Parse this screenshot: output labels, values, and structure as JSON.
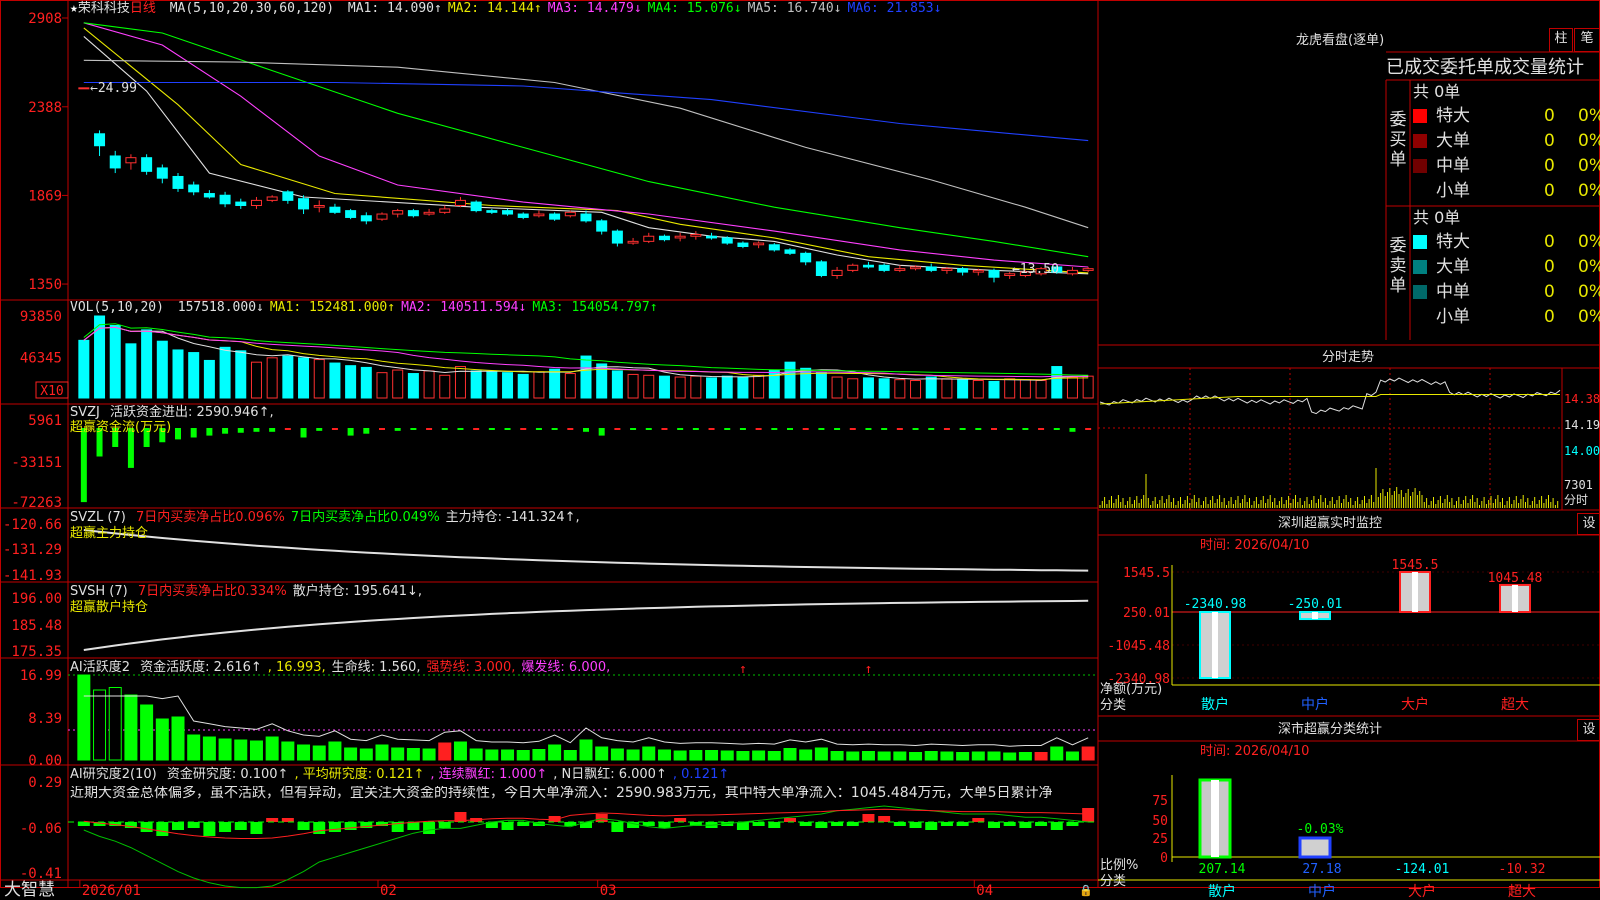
{
  "stock": {
    "name": "荣科科技",
    "period": "日线"
  },
  "panels": {
    "price": {
      "title": "MA(5,10,20,30,60,120)",
      "labels": [
        {
          "text": "MA1: 14.090↑",
          "color": "#e0e0e0"
        },
        {
          "text": "MA2: 14.144↑",
          "color": "#e8e800"
        },
        {
          "text": "MA3: 14.479↓",
          "color": "#ff40ff"
        },
        {
          "text": "MA4: 15.076↓",
          "color": "#00ff00"
        },
        {
          "text": "MA5: 16.740↓",
          "color": "#c0c0c0"
        },
        {
          "text": "MA6: 21.853↓",
          "color": "#2040ff"
        }
      ],
      "yticks": [
        "2908",
        "2388",
        "1869",
        "1350"
      ],
      "high_mark": "24.99",
      "low_mark": "13.50"
    },
    "vol": {
      "title": "VOL(5,10,20)",
      "labels": [
        {
          "text": "157518.000↓",
          "color": "#e0e0e0"
        },
        {
          "text": "MA1: 152481.000↑",
          "color": "#e8e800"
        },
        {
          "text": "MA2: 140511.594↓",
          "color": "#ff40ff"
        },
        {
          "text": "MA3: 154054.797↑",
          "color": "#00ff00"
        }
      ],
      "yticks": [
        "93850",
        "46345"
      ],
      "unit": "X10"
    },
    "svzj": {
      "title": "SVZJ",
      "labels": [
        {
          "text": "活跃资金进出: 2590.946↑,",
          "color": "#e0e0e0"
        }
      ],
      "subtitle": "超赢资金流(万元)",
      "yticks": [
        "5961",
        "-33151",
        "-72263"
      ]
    },
    "svzl": {
      "title": "SVZL (7)",
      "labels": [
        {
          "text": "7日内买卖净占比0.096%",
          "color": "#ff2020"
        },
        {
          "text": "7日内买卖净占比0.049%",
          "color": "#00ff00"
        },
        {
          "text": "主力持仓: -141.324↑,",
          "color": "#e0e0e0"
        }
      ],
      "subtitle": "超赢主力持仓",
      "yticks": [
        "-120.66",
        "-131.29",
        "-141.93"
      ]
    },
    "svsh": {
      "title": "SVSH (7)",
      "labels": [
        {
          "text": "7日内买卖净占比0.334%",
          "color": "#ff2020"
        },
        {
          "text": "散户持仓: 195.641↓,",
          "color": "#e0e0e0"
        }
      ],
      "subtitle": "超赢散户持仓",
      "yticks": [
        "196.00",
        "185.48",
        "175.35"
      ]
    },
    "ai1": {
      "title": "AI活跃度2",
      "labels": [
        {
          "text": "资金活跃度: 2.616↑",
          "color": "#e0e0e0"
        },
        {
          "text": ", 16.993,",
          "color": "#e8e800"
        },
        {
          "text": "生命线: 1.560,",
          "color": "#e0e0e0"
        },
        {
          "text": "强势线: 3.000,",
          "color": "#ff2020"
        },
        {
          "text": "爆发线: 6.000,",
          "color": "#ff40ff"
        }
      ],
      "yticks": [
        "16.99",
        "8.39",
        "0.00"
      ]
    },
    "ai2": {
      "title": "AI研究度2(10)",
      "labels": [
        {
          "text": "资金研究度: 0.100↑",
          "color": "#e0e0e0"
        },
        {
          "text": ", 平均研究度: 0.121↑",
          "color": "#e8e800"
        },
        {
          "text": ", 连续飘红: 1.000↑",
          "color": "#ff40ff"
        },
        {
          "text": ", N日飘红: 6.000↑",
          "color": "#e0e0e0"
        },
        {
          "text": ", 0.121↑",
          "color": "#2040ff"
        }
      ],
      "comment": "近期大资金总体偏多，虽不活跃，但有异动，宜关注大资金的持续性，今日大单净流入：2590.983万元，其中特大单净流入：1045.484万元，大单5日累计净",
      "yticks": [
        "0.29",
        "-0.06",
        "-0.41"
      ]
    }
  },
  "x_axis": [
    "2026/01",
    "02",
    "03",
    "04"
  ],
  "brand": "大智慧",
  "right": {
    "lhkp": {
      "title": "龙虎看盘(逐单)",
      "btn1": "柱",
      "btn2": "笔",
      "subtitle": "已成交委托单成交量统计",
      "buy": {
        "side_label": "委买单",
        "total": "共 0单",
        "rows": [
          {
            "name": "特大",
            "count": "0",
            "pct": "0%",
            "color": "#ff0000"
          },
          {
            "name": "大单",
            "count": "0",
            "pct": "0%",
            "color": "#900000"
          },
          {
            "name": "中单",
            "count": "0",
            "pct": "0%",
            "color": "#700000"
          },
          {
            "name": "小单",
            "count": "0",
            "pct": "0%",
            "color": "#000000"
          }
        ]
      },
      "sell": {
        "side_label": "委卖单",
        "total": "共 0单",
        "rows": [
          {
            "name": "特大",
            "count": "0",
            "pct": "0%",
            "color": "#00ffff"
          },
          {
            "name": "大单",
            "count": "0",
            "pct": "0%",
            "color": "#008080"
          },
          {
            "name": "中单",
            "count": "0",
            "pct": "0%",
            "color": "#006868"
          },
          {
            "name": "小单",
            "count": "0",
            "pct": "0%",
            "color": "#000000"
          }
        ]
      }
    },
    "intraday": {
      "title": "分时走势",
      "yticks": [
        "14.38",
        "14.19",
        "14.00"
      ],
      "vol_label": "7301",
      "unit": "分时"
    },
    "sz_monitor": {
      "title": "深圳超赢实时监控",
      "btn": "设",
      "time": "时间: 2026/04/10",
      "yticks": [
        "1545.5",
        "250.01",
        "-1045.48",
        "-2340.98"
      ],
      "ylabel": "净额(万元)",
      "xlabel": "分类",
      "chart_data": {
        "type": "bar",
        "categories": [
          "散户",
          "中户",
          "大户",
          "超大"
        ],
        "values": [
          -2340.98,
          -250.01,
          1545.5,
          1045.48
        ],
        "value_labels": [
          "-2340.98",
          "-250.01",
          "1545.5",
          "1045.48"
        ],
        "ylim": [
          -2340.98,
          1545.5
        ]
      }
    },
    "sz_class": {
      "title": "深市超赢分类统计",
      "btn": "设",
      "time": "时间: 2026/04/10",
      "yticks": [
        "75",
        "50",
        "25",
        "0"
      ],
      "ylabel": "比例%",
      "xlabel": "分类",
      "chart_data": {
        "type": "bar",
        "categories": [
          "散户",
          "中户",
          "大户",
          "超大"
        ],
        "values": [
          207.14,
          27.18,
          -124.01,
          -10.32
        ],
        "pct_label": "-0.03%",
        "value_labels": [
          "207.14",
          "27.18",
          "-124.01",
          "-10.32"
        ]
      }
    }
  },
  "chart_data": [
    {
      "type": "candlestick",
      "panel": "price",
      "ylim": [
        12.8,
        29.08
      ],
      "candles": [
        [
          24.99,
          24.99,
          22.9,
          22.9
        ],
        [
          22.3,
          21.6,
          21.0,
          22.5
        ],
        [
          21.0,
          20.3,
          20.0,
          21.3
        ],
        [
          20.6,
          20.9,
          20.2,
          21.1
        ],
        [
          20.9,
          20.1,
          19.9,
          21.1
        ],
        [
          20.3,
          19.7,
          19.4,
          20.5
        ],
        [
          19.8,
          19.1,
          18.9,
          20.0
        ],
        [
          19.3,
          18.9,
          18.7,
          19.5
        ],
        [
          18.8,
          18.6,
          18.5,
          19.0
        ],
        [
          18.7,
          18.2,
          18.0,
          18.9
        ],
        [
          18.3,
          18.1,
          17.9,
          18.5
        ],
        [
          18.1,
          18.4,
          17.9,
          18.6
        ],
        [
          18.4,
          18.6,
          18.3,
          18.7
        ],
        [
          18.9,
          18.4,
          18.2,
          19.0
        ],
        [
          18.5,
          17.9,
          17.6,
          18.7
        ],
        [
          18.0,
          18.1,
          17.7,
          18.4
        ],
        [
          18.0,
          17.7,
          17.6,
          18.2
        ],
        [
          17.8,
          17.4,
          17.3,
          17.9
        ],
        [
          17.5,
          17.2,
          17.0,
          17.7
        ],
        [
          17.3,
          17.6,
          17.2,
          17.7
        ],
        [
          17.6,
          17.8,
          17.4,
          17.9
        ],
        [
          17.8,
          17.5,
          17.4,
          17.9
        ],
        [
          17.6,
          17.7,
          17.5,
          17.9
        ],
        [
          17.7,
          17.9,
          17.6,
          18.1
        ],
        [
          18.1,
          18.4,
          18.0,
          18.6
        ],
        [
          18.3,
          17.8,
          17.7,
          18.4
        ],
        [
          17.8,
          17.7,
          17.6,
          17.9
        ],
        [
          17.8,
          17.6,
          17.5,
          17.9
        ],
        [
          17.6,
          17.4,
          17.3,
          17.7
        ],
        [
          17.5,
          17.6,
          17.4,
          17.8
        ],
        [
          17.6,
          17.3,
          17.2,
          17.7
        ],
        [
          17.5,
          17.7,
          17.4,
          17.8
        ],
        [
          17.6,
          17.2,
          17.1,
          17.8
        ],
        [
          17.2,
          16.6,
          16.4,
          17.3
        ],
        [
          16.6,
          15.9,
          15.7,
          16.7
        ],
        [
          15.9,
          16.0,
          15.8,
          16.2
        ],
        [
          16.0,
          16.3,
          15.9,
          16.5
        ],
        [
          16.3,
          16.1,
          16.0,
          16.4
        ],
        [
          16.2,
          16.3,
          16.0,
          16.5
        ],
        [
          16.3,
          16.4,
          16.1,
          16.6
        ],
        [
          16.3,
          16.2,
          16.1,
          16.5
        ],
        [
          16.2,
          15.9,
          15.8,
          16.3
        ],
        [
          15.9,
          15.7,
          15.6,
          16.0
        ],
        [
          15.8,
          15.9,
          15.6,
          16.0
        ],
        [
          15.8,
          15.5,
          15.4,
          15.9
        ],
        [
          15.5,
          15.3,
          15.2,
          15.6
        ],
        [
          15.3,
          14.8,
          14.6,
          15.4
        ],
        [
          14.8,
          14.0,
          13.9,
          14.9
        ],
        [
          14.0,
          14.3,
          13.8,
          14.5
        ],
        [
          14.3,
          14.6,
          14.2,
          14.7
        ],
        [
          14.6,
          14.5,
          14.4,
          14.8
        ],
        [
          14.6,
          14.3,
          14.2,
          14.7
        ],
        [
          14.3,
          14.4,
          14.2,
          14.6
        ],
        [
          14.4,
          14.5,
          14.3,
          14.6
        ],
        [
          14.5,
          14.3,
          14.2,
          14.7
        ],
        [
          14.3,
          14.4,
          14.1,
          14.5
        ],
        [
          14.4,
          14.2,
          14.0,
          14.5
        ],
        [
          14.2,
          14.3,
          14.0,
          14.4
        ],
        [
          14.3,
          13.9,
          13.6,
          14.4
        ],
        [
          14.0,
          14.1,
          13.8,
          14.2
        ],
        [
          14.0,
          14.2,
          13.9,
          14.3
        ],
        [
          14.1,
          14.4,
          14.0,
          14.5
        ],
        [
          14.5,
          14.2,
          14.1,
          14.6
        ],
        [
          14.1,
          14.3,
          14.0,
          14.5
        ],
        [
          14.3,
          14.4,
          14.2,
          14.5
        ]
      ],
      "ma": {
        "ma5": [
          [
            0,
            28.0
          ],
          [
            4,
            24.8
          ],
          [
            8,
            20.0
          ],
          [
            14,
            18.6
          ],
          [
            25,
            18.0
          ],
          [
            33,
            17.7
          ],
          [
            36,
            16.8
          ],
          [
            40,
            16.3
          ],
          [
            44,
            16.0
          ],
          [
            48,
            15.2
          ],
          [
            52,
            14.6
          ],
          [
            58,
            14.3
          ],
          [
            64,
            14.1
          ]
        ],
        "ma10": [
          [
            0,
            28.5
          ],
          [
            6,
            24.0
          ],
          [
            10,
            20.5
          ],
          [
            16,
            18.8
          ],
          [
            26,
            18.1
          ],
          [
            34,
            17.8
          ],
          [
            38,
            17.0
          ],
          [
            44,
            16.2
          ],
          [
            50,
            15.1
          ],
          [
            56,
            14.6
          ],
          [
            64,
            14.15
          ]
        ],
        "ma20": [
          [
            0,
            28.8
          ],
          [
            5,
            27.5
          ],
          [
            10,
            24.5
          ],
          [
            15,
            21.0
          ],
          [
            20,
            19.3
          ],
          [
            28,
            18.3
          ],
          [
            36,
            17.6
          ],
          [
            44,
            16.6
          ],
          [
            52,
            15.5
          ],
          [
            58,
            14.9
          ],
          [
            64,
            14.5
          ]
        ],
        "ma30": [
          [
            0,
            28.8
          ],
          [
            5,
            28.2
          ],
          [
            12,
            26.0
          ],
          [
            20,
            23.5
          ],
          [
            28,
            21.5
          ],
          [
            36,
            19.5
          ],
          [
            44,
            18.0
          ],
          [
            52,
            16.8
          ],
          [
            58,
            16.0
          ],
          [
            64,
            15.1
          ]
        ],
        "ma60": [
          [
            0,
            26.6
          ],
          [
            10,
            26.5
          ],
          [
            20,
            26.2
          ],
          [
            30,
            25.3
          ],
          [
            38,
            23.8
          ],
          [
            46,
            21.5
          ],
          [
            54,
            19.6
          ],
          [
            60,
            18.0
          ],
          [
            64,
            16.8
          ]
        ],
        "ma120": [
          [
            0,
            25.3
          ],
          [
            16,
            25.3
          ],
          [
            28,
            25.1
          ],
          [
            40,
            24.3
          ],
          [
            52,
            22.9
          ],
          [
            64,
            21.9
          ]
        ]
      }
    },
    {
      "type": "bar",
      "panel": "vol",
      "ylim": [
        0,
        93850
      ],
      "values": [
        66000,
        93850,
        83000,
        62000,
        78000,
        65000,
        55000,
        52000,
        43000,
        58000,
        54000,
        41000,
        46000,
        48000,
        46000,
        44000,
        40000,
        37000,
        35000,
        29000,
        32000,
        28000,
        31000,
        26000,
        36000,
        31000,
        30000,
        29000,
        27000,
        30000,
        33000,
        28000,
        48000,
        39000,
        31000,
        27000,
        26000,
        25000,
        24000,
        25000,
        23000,
        25000,
        24000,
        26000,
        32000,
        41000,
        34000,
        29000,
        24000,
        22000,
        23000,
        22000,
        21000,
        20000,
        24000,
        22000,
        21000,
        20000,
        19000,
        22000,
        21000,
        20000,
        36000,
        24000,
        25000
      ],
      "up": [
        0,
        0,
        0,
        0,
        0,
        0,
        0,
        0,
        0,
        0,
        0,
        1,
        1,
        0,
        0,
        1,
        0,
        0,
        0,
        1,
        1,
        0,
        1,
        1,
        1,
        0,
        0,
        0,
        0,
        1,
        0,
        1,
        0,
        0,
        0,
        1,
        1,
        0,
        1,
        1,
        0,
        0,
        0,
        1,
        0,
        0,
        0,
        0,
        1,
        1,
        0,
        0,
        1,
        1,
        0,
        1,
        0,
        1,
        0,
        1,
        1,
        1,
        0,
        1,
        1
      ]
    }
  ]
}
